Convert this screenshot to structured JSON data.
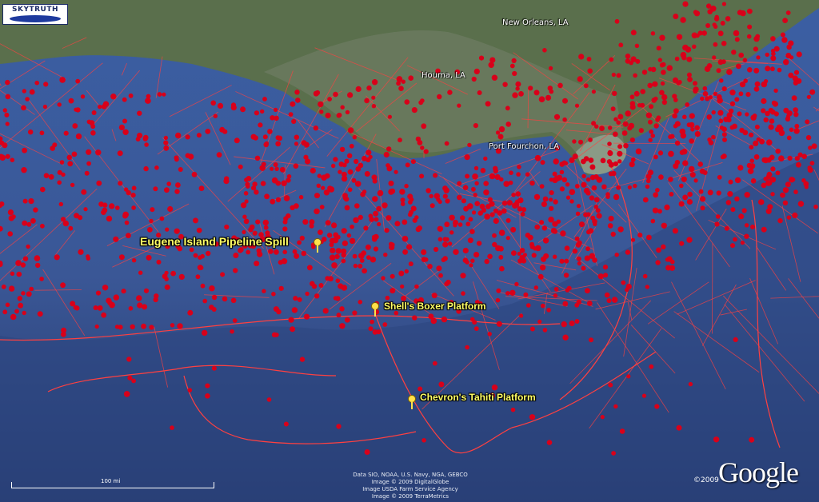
{
  "branding": {
    "logo_text": "SKYTRUTH"
  },
  "places": [
    {
      "name": "New Orleans, LA"
    },
    {
      "name": "Houma, LA"
    },
    {
      "name": "Port Fourchon, LA"
    }
  ],
  "placemarks": [
    {
      "name": "Eugene Island Pipeline Spill"
    },
    {
      "name": "Shell's Boxer Platform"
    },
    {
      "name": "Chevron's Tahiti Platform"
    }
  ],
  "credits": [
    "Data SIO, NOAA, U.S. Navy, NGA, GEBCO",
    "Image © 2009 DigitalGlobe",
    "Image USDA Farm Service Agency",
    "Image © 2009 TerraMetrics"
  ],
  "scale": {
    "label": "100 mi"
  },
  "watermark": {
    "copyright": "©2009",
    "name": "Google"
  },
  "colors": {
    "ocean": "#2f4e8c",
    "land": "#566b4a",
    "marker": "#d8001a",
    "pipeline": "#ff4040",
    "label": "#ffff66"
  }
}
